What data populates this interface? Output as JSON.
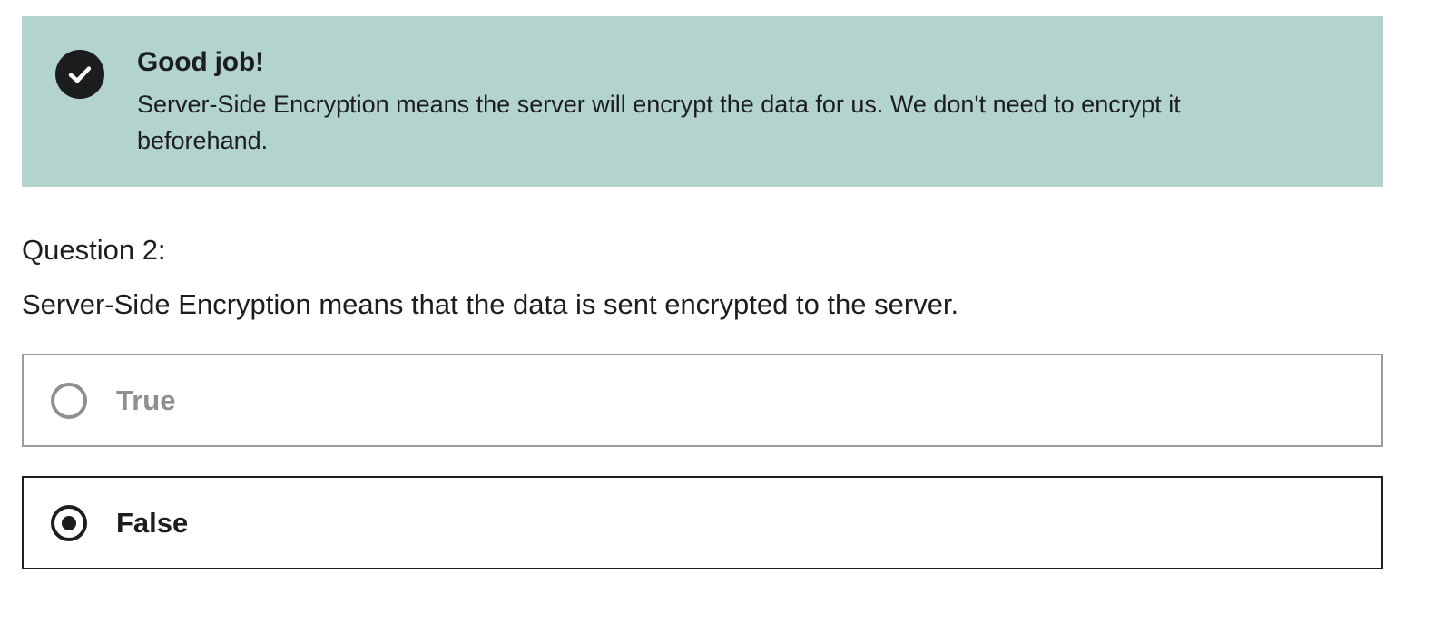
{
  "feedback": {
    "icon": "check-circle-icon",
    "title": "Good job!",
    "text": "Server-Side Encryption means the server will encrypt the data for us. We don't need to encrypt it beforehand.",
    "background_color": "#b3d4ce"
  },
  "question": {
    "label": "Question 2:",
    "text": "Server-Side Encryption means that the data is sent encrypted to the server."
  },
  "options": [
    {
      "label": "True",
      "selected": false
    },
    {
      "label": "False",
      "selected": true
    }
  ],
  "colors": {
    "text": "#1c1d1f",
    "muted": "#8e8f90",
    "border_muted": "#9a9b9c"
  }
}
